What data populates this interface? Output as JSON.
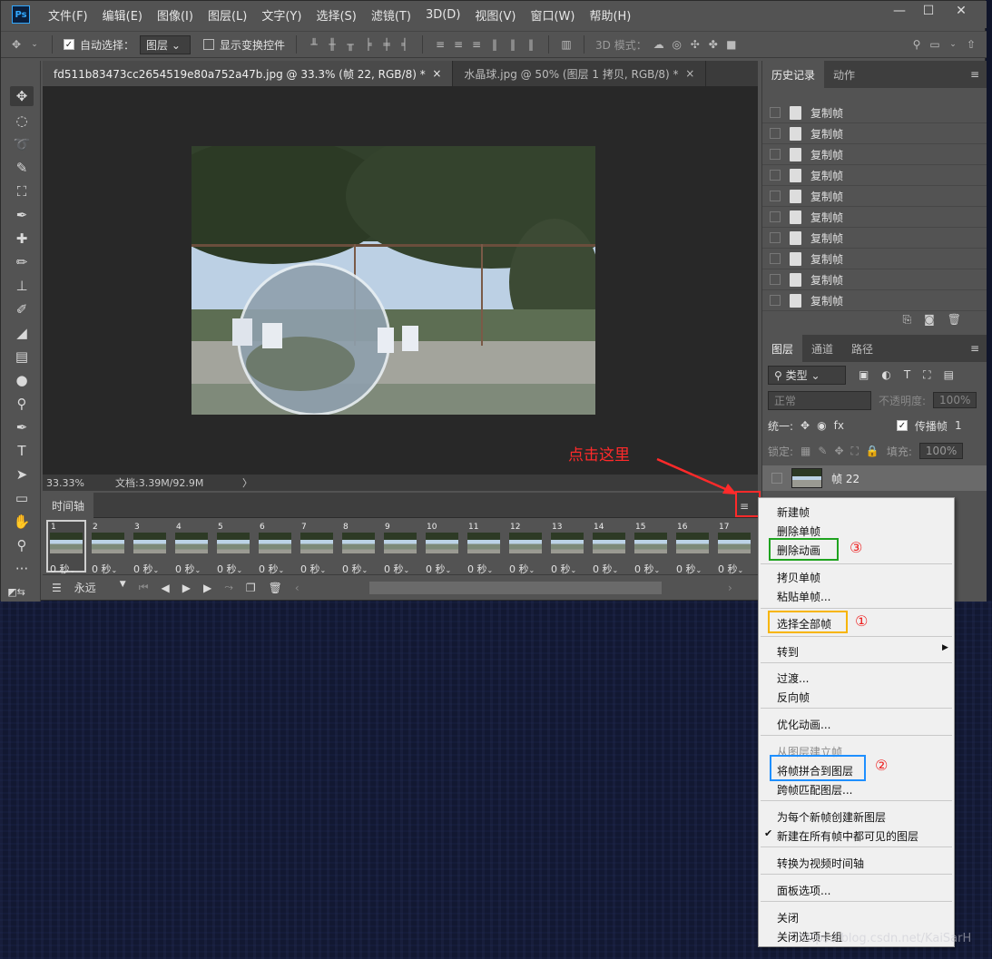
{
  "menubar": {
    "logo": "Ps",
    "items": [
      "文件(F)",
      "编辑(E)",
      "图像(I)",
      "图层(L)",
      "文字(Y)",
      "选择(S)",
      "滤镜(T)",
      "3D(D)",
      "视图(V)",
      "窗口(W)",
      "帮助(H)"
    ],
    "window_controls": [
      "—",
      "☐",
      "✕"
    ]
  },
  "options": {
    "auto_select_label": "自动选择：",
    "auto_select_value": "图层",
    "show_transform_label": "显示变换控件",
    "mode_3d_label": "3D 模式："
  },
  "doc_tabs": [
    {
      "label": "fd511b83473cc2654519e80a752a47b.jpg @ 33.3% (帧 22, RGB/8) *",
      "close": "×"
    },
    {
      "label": "水晶球.jpg @ 50% (图层 1 拷贝, RGB/8) *",
      "close": "×"
    }
  ],
  "status": {
    "zoom": "33.33%",
    "doc": "文档:3.39M/92.9M",
    "arrow": "〉"
  },
  "timeline": {
    "tab_label": "时间轴",
    "frames": [
      {
        "num": "1",
        "dur": "0 秒"
      },
      {
        "num": "2",
        "dur": "0 秒"
      },
      {
        "num": "3",
        "dur": "0 秒"
      },
      {
        "num": "4",
        "dur": "0 秒"
      },
      {
        "num": "5",
        "dur": "0 秒"
      },
      {
        "num": "6",
        "dur": "0 秒"
      },
      {
        "num": "7",
        "dur": "0 秒"
      },
      {
        "num": "8",
        "dur": "0 秒"
      },
      {
        "num": "9",
        "dur": "0 秒"
      },
      {
        "num": "10",
        "dur": "0 秒"
      },
      {
        "num": "11",
        "dur": "0 秒"
      },
      {
        "num": "12",
        "dur": "0 秒"
      },
      {
        "num": "13",
        "dur": "0 秒"
      },
      {
        "num": "14",
        "dur": "0 秒"
      },
      {
        "num": "15",
        "dur": "0 秒"
      },
      {
        "num": "16",
        "dur": "0 秒"
      },
      {
        "num": "17",
        "dur": "0 秒"
      }
    ],
    "loop_value": "永远"
  },
  "history_panel": {
    "tabs": [
      "历史记录",
      "动作"
    ],
    "items": [
      "复制帧",
      "复制帧",
      "复制帧",
      "复制帧",
      "复制帧",
      "复制帧",
      "复制帧",
      "复制帧",
      "复制帧",
      "复制帧"
    ]
  },
  "layers_panel": {
    "tabs": [
      "图层",
      "通道",
      "路径"
    ],
    "kind_filter": "类型",
    "blend_mode": "正常",
    "opacity_label": "不透明度:",
    "opacity_value": "100%",
    "unify_label": "统一:",
    "propagate_label": "传播帧",
    "propagate_value": "1",
    "lock_label": "锁定:",
    "fill_label": "填充:",
    "fill_value": "100%",
    "layer_name": "帧 22"
  },
  "annotation": {
    "text": "点击这里"
  },
  "context_menu": {
    "items": [
      {
        "label": "新建帧",
        "disabled": false
      },
      {
        "label": "删除单帧",
        "disabled": false
      },
      {
        "label": "删除动画",
        "disabled": false,
        "marker": "③"
      },
      {
        "label": "拷贝单帧",
        "disabled": false
      },
      {
        "label": "粘贴单帧...",
        "disabled": false
      },
      {
        "label": "选择全部帧",
        "disabled": false,
        "marker": "①"
      },
      {
        "label": "转到",
        "disabled": false,
        "submenu": "▶"
      },
      {
        "label": "过渡...",
        "disabled": false
      },
      {
        "label": "反向帧",
        "disabled": false
      },
      {
        "label": "优化动画...",
        "disabled": false
      },
      {
        "label": "从图层建立帧",
        "disabled": true
      },
      {
        "label": "将帧拼合到图层",
        "disabled": false,
        "marker": "②"
      },
      {
        "label": "跨帧匹配图层...",
        "disabled": false
      },
      {
        "label": "为每个新帧创建新图层",
        "disabled": false
      },
      {
        "label": "新建在所有帧中都可见的图层",
        "disabled": false,
        "checked": "✔"
      },
      {
        "label": "转换为视频时间轴",
        "disabled": false
      },
      {
        "label": "面板选项...",
        "disabled": false
      },
      {
        "label": "关闭",
        "disabled": false
      },
      {
        "label": "关闭选项卡组",
        "disabled": false
      }
    ]
  },
  "watermark": "https://blog.csdn.net/KaiSarH",
  "colors": {
    "marker_red": "#ff2a2a",
    "box_yellow": "#f7b500",
    "box_blue": "#1e8fff",
    "box_green": "#1fa31f"
  }
}
